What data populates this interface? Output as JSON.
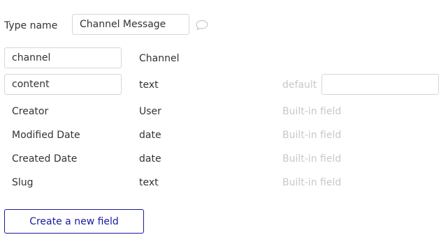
{
  "header": {
    "type_name_label": "Type name",
    "type_name_value": "Channel Message",
    "comment_icon": "speech-bubble-icon"
  },
  "fields": {
    "editable": [
      {
        "name": "channel",
        "type": "Channel"
      },
      {
        "name": "content",
        "type": "text",
        "default_label": "default",
        "default_value": ""
      }
    ],
    "builtin": [
      {
        "name": "Creator",
        "type": "User",
        "note": "Built-in field"
      },
      {
        "name": "Modified Date",
        "type": "date",
        "note": "Built-in field"
      },
      {
        "name": "Created Date",
        "type": "date",
        "note": "Built-in field"
      },
      {
        "name": "Slug",
        "type": "text",
        "note": "Built-in field"
      }
    ]
  },
  "actions": {
    "create_field_label": "Create a new field"
  },
  "colors": {
    "accent": "#1a1a9e",
    "border": "#d6d6d6",
    "muted_text": "#c8c8c8",
    "text": "#333333"
  }
}
